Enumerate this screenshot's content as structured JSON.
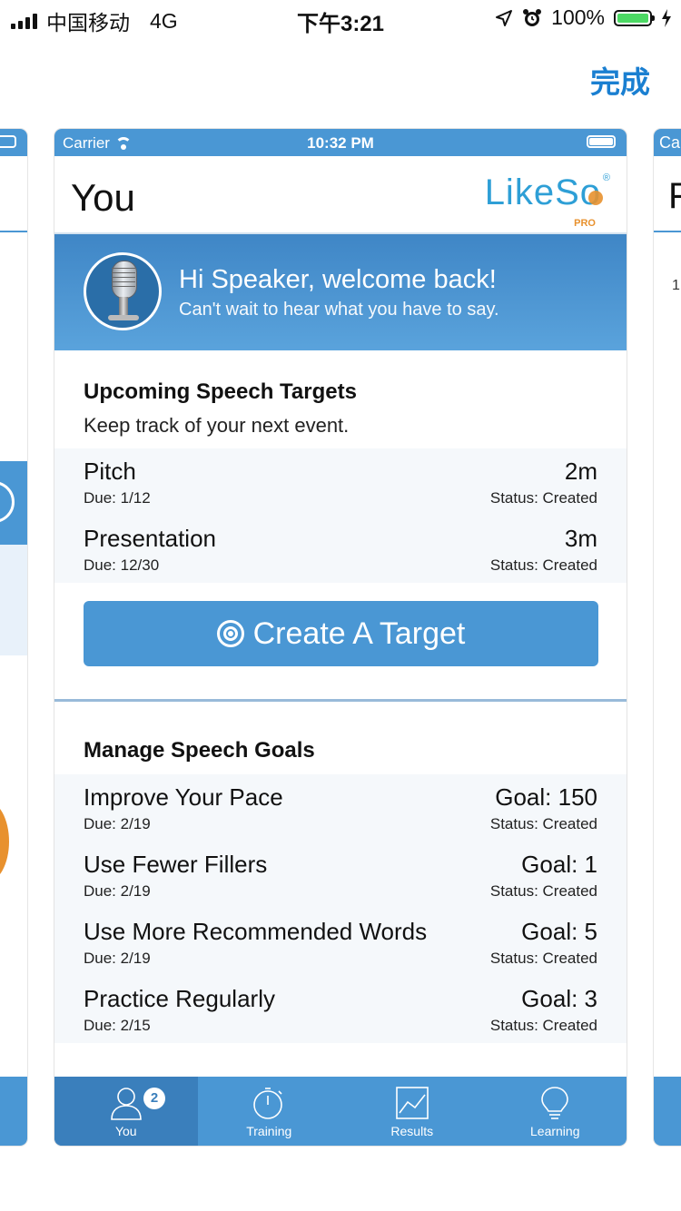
{
  "status_bar": {
    "carrier": "中国移动",
    "network": "4G",
    "time": "下午3:21",
    "battery": "100%",
    "battery_level": 1.0
  },
  "done_label": "完成",
  "left_card": {
    "letter": ""
  },
  "right_card": {
    "carrier_partial": "Ca",
    "letter": "F",
    "number": "1"
  },
  "card": {
    "inner_status": {
      "carrier": "Carrier",
      "time": "10:32 PM"
    },
    "header": {
      "title": "You",
      "logo_text": "LikeSo",
      "logo_badge": "PRO"
    },
    "welcome": {
      "greeting": "Hi Speaker, welcome back!",
      "subtitle": "Can't wait to hear what you have to say."
    },
    "targets": {
      "title": "Upcoming Speech Targets",
      "description": "Keep track of your next event.",
      "items": [
        {
          "name": "Pitch",
          "due": "Due: 1/12",
          "value": "2m",
          "status": "Status: Created"
        },
        {
          "name": "Presentation",
          "due": "Due: 12/30",
          "value": "3m",
          "status": "Status: Created"
        }
      ],
      "create_button": "Create A Target"
    },
    "goals": {
      "title": "Manage Speech Goals",
      "items": [
        {
          "name": "Improve Your Pace",
          "due": "Due: 2/19",
          "value": "Goal: 150",
          "status": "Status: Created"
        },
        {
          "name": "Use Fewer Fillers",
          "due": "Due: 2/19",
          "value": "Goal: 1",
          "status": "Status: Created"
        },
        {
          "name": "Use More Recommended Words",
          "due": "Due: 2/19",
          "value": "Goal: 5",
          "status": "Status: Created"
        },
        {
          "name": "Practice Regularly",
          "due": "Due: 2/15",
          "value": "Goal: 3",
          "status": "Status: Created"
        }
      ]
    },
    "tabbar": {
      "tabs": [
        {
          "label": "You",
          "icon": "person-icon",
          "badge": "2"
        },
        {
          "label": "Training",
          "icon": "stopwatch-icon"
        },
        {
          "label": "Results",
          "icon": "chart-icon"
        },
        {
          "label": "Learning",
          "icon": "lightbulb-icon"
        }
      ]
    }
  },
  "colors": {
    "accent": "#4a97d4",
    "accent_dark": "#3a7fbc",
    "done": "#1a7fd1",
    "logo": "#2e9fd6",
    "logo_orange": "#e8912e",
    "battery_green": "#4cd964"
  }
}
